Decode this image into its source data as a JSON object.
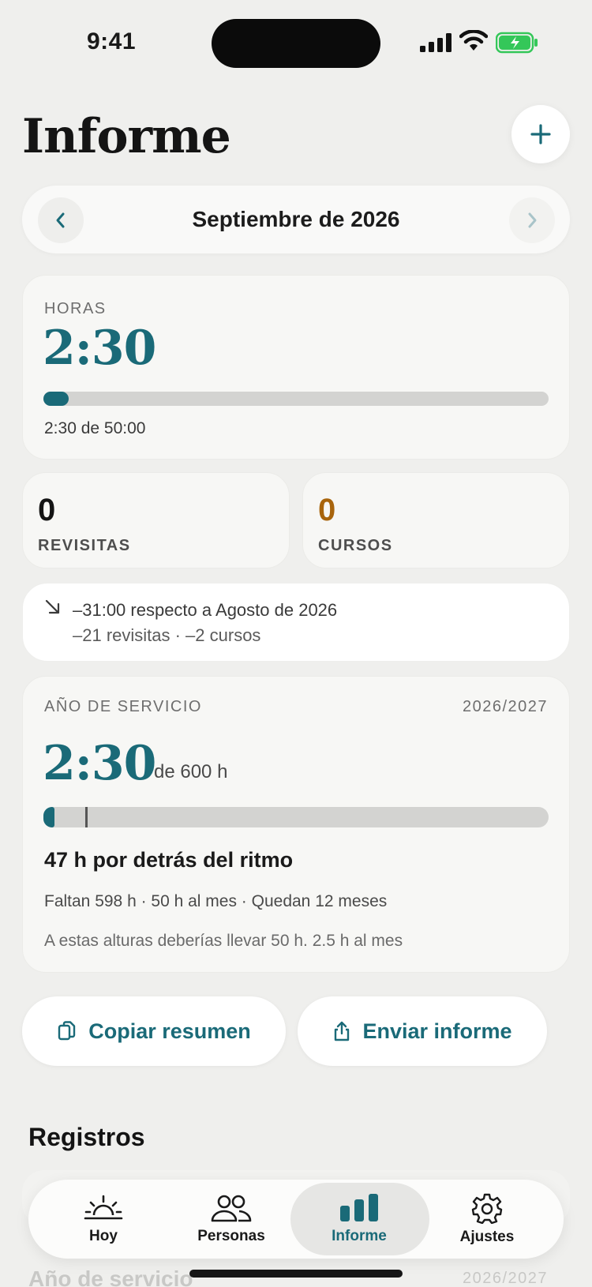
{
  "status_bar": {
    "time": "9:41"
  },
  "header": {
    "title": "Informe"
  },
  "month_selector": {
    "label": "Septiembre de 2026"
  },
  "hours": {
    "label": "HORAS",
    "value": "2:30",
    "caption": "2:30 de 50:00",
    "progress": 0.05
  },
  "stats": [
    {
      "value": "0",
      "label": "REVISITAS",
      "color": "#141414"
    },
    {
      "value": "0",
      "label": "CURSOS",
      "color": "#a8640c"
    }
  ],
  "comparison": {
    "line1": "–31:00 respecto a Agosto de 2026",
    "line2": "–21 revisitas · –2 cursos"
  },
  "service_year": {
    "label": "AÑO DE SERVICIO",
    "range": "2026/2027",
    "value": "2:30",
    "target": "de 600 h",
    "progress": 0.004,
    "status": "47 h por detrás del ritmo",
    "detail": "Faltan 598 h · 50 h al mes · Quedan 12 meses",
    "note": "A estas alturas deberías llevar 50 h. 2.5 h al mes"
  },
  "actions": {
    "copy_label": "Copiar resumen",
    "send_label": "Enviar informe"
  },
  "records": {
    "title": "Registros"
  },
  "background_rows": {
    "section_title": "Año de servicio",
    "range": "2026/2027"
  },
  "tabs": [
    {
      "label": "Hoy",
      "icon": "sunrise-icon"
    },
    {
      "label": "Personas",
      "icon": "people-icon"
    },
    {
      "label": "Informe",
      "icon": "bar-chart-icon",
      "active": true
    },
    {
      "label": "Ajustes",
      "icon": "gear-icon"
    }
  ],
  "colors": {
    "accent": "#1a6a78",
    "courses": "#a8640c",
    "battery": "#34c759"
  }
}
